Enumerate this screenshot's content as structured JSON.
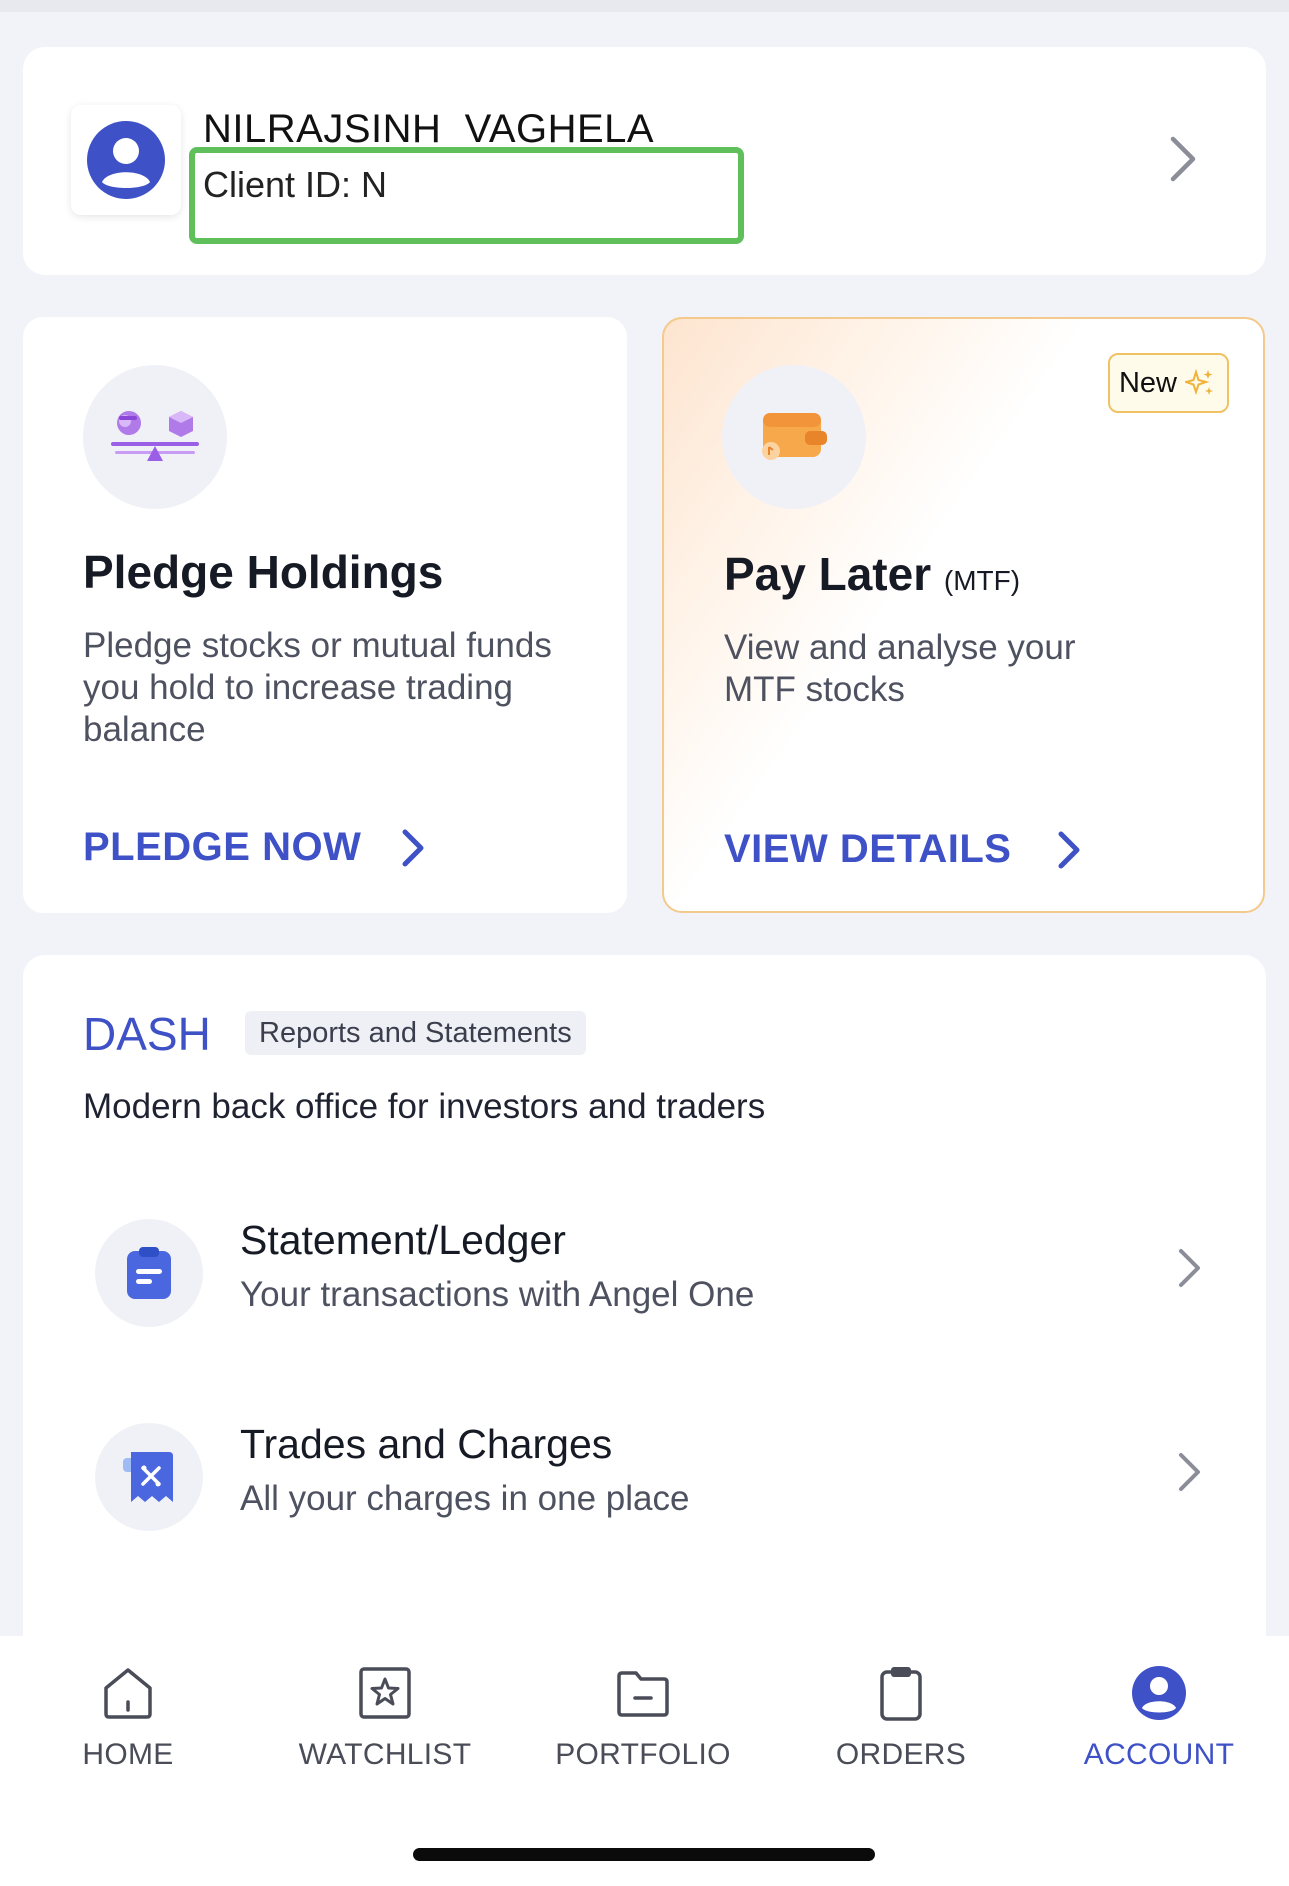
{
  "profile": {
    "name": "NILRAJSINH  VAGHELA",
    "client_id": "Client ID: N"
  },
  "pledge": {
    "title": "Pledge Holdings",
    "description": "Pledge stocks or mutual funds you hold to increase trading balance",
    "action": "PLEDGE NOW"
  },
  "pay_later": {
    "badge": "New",
    "title": "Pay Later",
    "title_suffix": "(MTF)",
    "description": "View and analyse your MTF stocks",
    "action": "VIEW DETAILS"
  },
  "dash": {
    "title": "DASH",
    "tag": "Reports and Statements",
    "subtitle": "Modern back office for investors and traders",
    "rows": [
      {
        "title": "Statement/Ledger",
        "description": "Your transactions with Angel One"
      },
      {
        "title": "Trades and Charges",
        "description": "All your charges in one place"
      }
    ]
  },
  "nav": {
    "items": [
      {
        "label": "HOME",
        "icon": "home-icon"
      },
      {
        "label": "WATCHLIST",
        "icon": "star-icon"
      },
      {
        "label": "PORTFOLIO",
        "icon": "folder-icon"
      },
      {
        "label": "ORDERS",
        "icon": "clipboard-icon"
      },
      {
        "label": "ACCOUNT",
        "icon": "user-icon"
      }
    ],
    "active": "ACCOUNT"
  },
  "colors": {
    "accent": "#3f51c6",
    "highlight": "#5fbf5a",
    "badge_border": "#f0c264"
  }
}
